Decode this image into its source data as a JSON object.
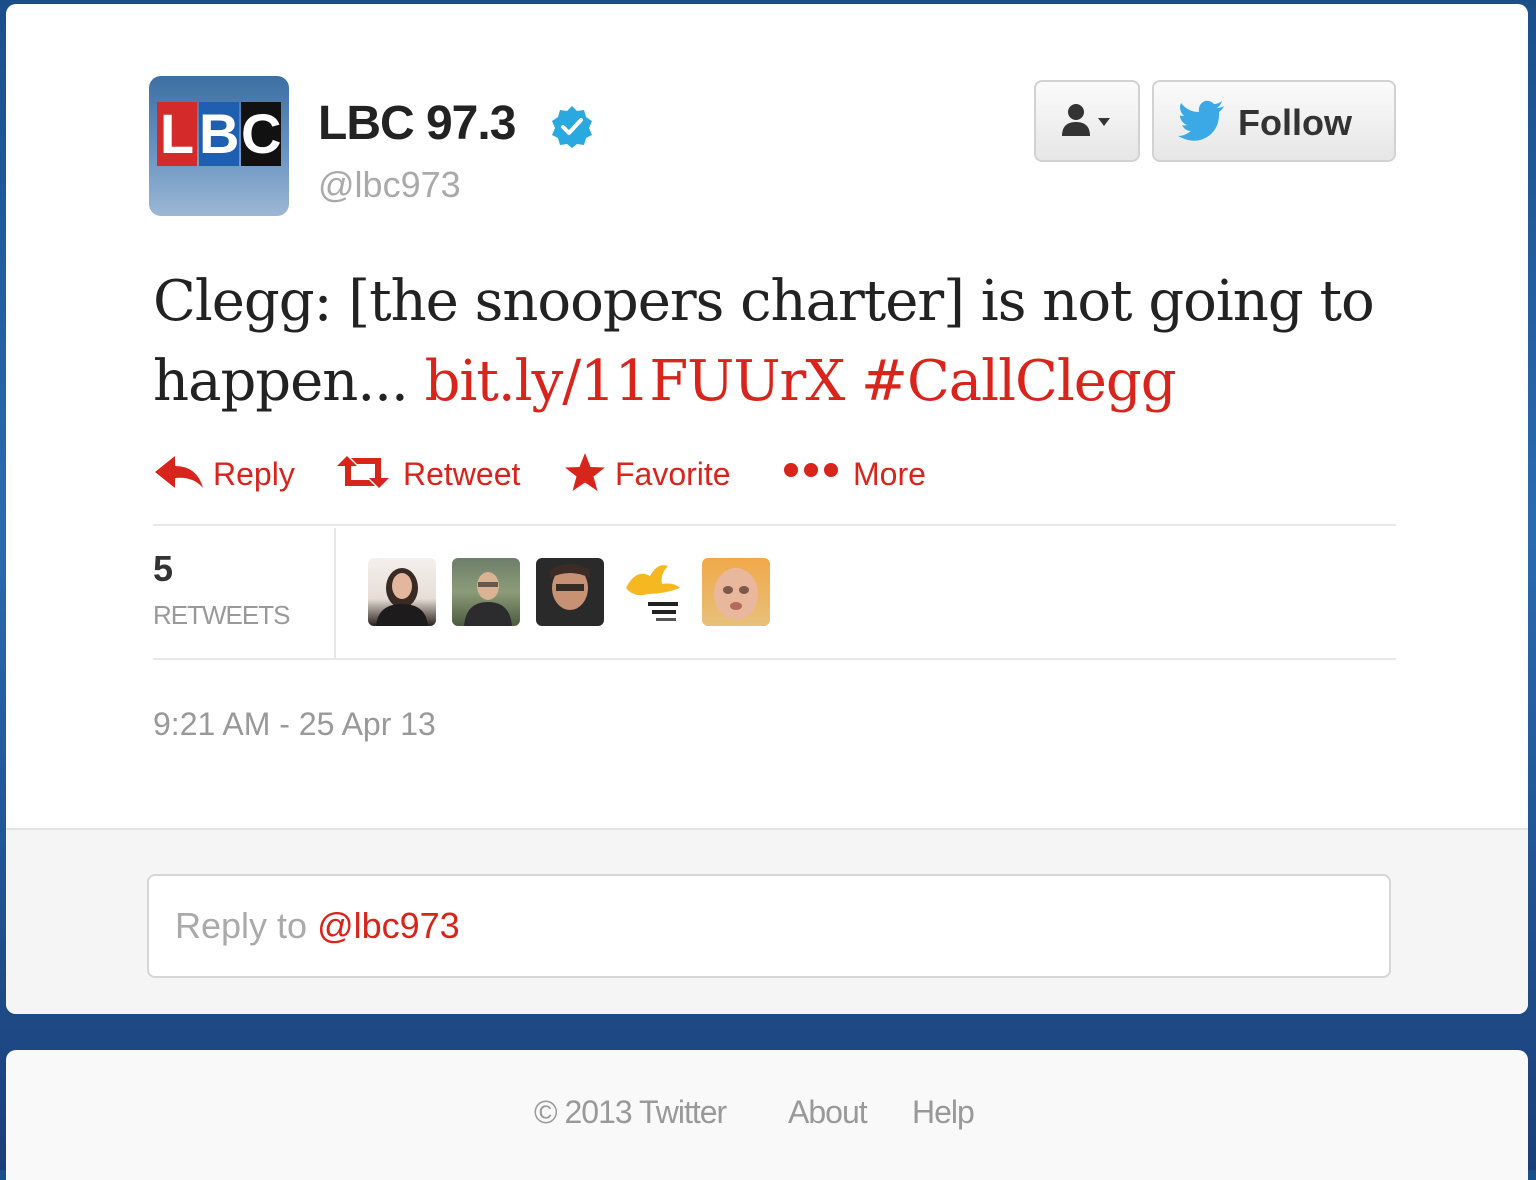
{
  "profile": {
    "avatar_text": [
      "L",
      "B",
      "C"
    ],
    "display_name": "LBC 97.3",
    "handle": "@lbc973",
    "verified": true,
    "icons": {
      "verified": "verified-badge-icon",
      "user_menu": "person-dropdown-icon",
      "follow": "twitter-bird-icon"
    }
  },
  "buttons": {
    "follow_label": "Follow"
  },
  "tweet": {
    "text_prefix": "Clegg: [the snoopers charter] is not going to happen...",
    "link": "bit.ly/11FUUrX",
    "hashtag": "#CallClegg"
  },
  "actions": [
    {
      "label": "Reply",
      "icon": "reply-arrow-icon"
    },
    {
      "label": "Retweet",
      "icon": "retweet-icon"
    },
    {
      "label": "Favorite",
      "icon": "star-icon"
    },
    {
      "label": "More",
      "icon": "more-dots-icon"
    }
  ],
  "stats": {
    "retweets_count": "5",
    "retweets_label": "RETWEETS",
    "retweeter_avatars": 5
  },
  "timestamp": "9:21 AM - 25 Apr 13",
  "reply": {
    "prefix": "Reply to ",
    "mention": "@lbc973"
  },
  "footer": {
    "copyright": "© 2013 Twitter",
    "about": "About",
    "help": "Help"
  },
  "colors": {
    "accent": "#d9241c",
    "verified": "#2aa9e0",
    "bird": "#3ba9e6"
  }
}
